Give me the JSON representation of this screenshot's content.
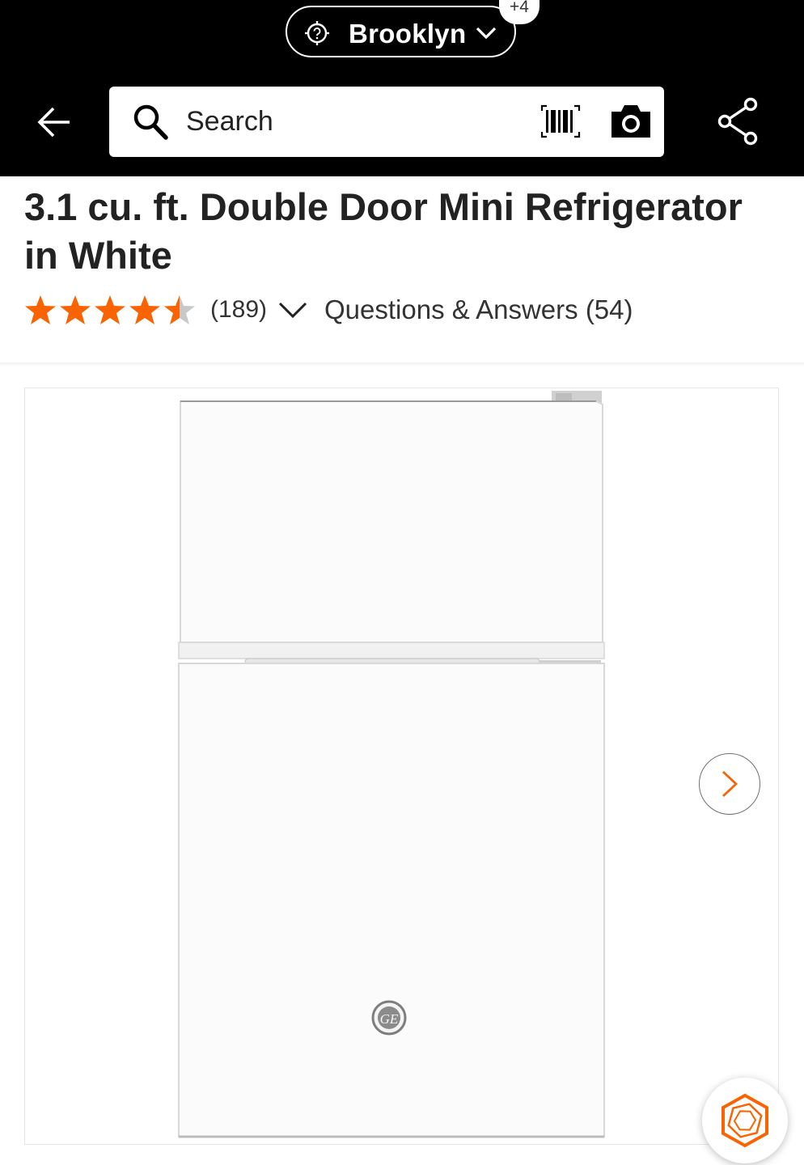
{
  "header": {
    "store": {
      "name": "Brooklyn",
      "badge": "+4"
    },
    "search": {
      "placeholder": "Search"
    },
    "icons": [
      "back-arrow-icon",
      "store-pin-icon",
      "chevron-down-icon",
      "search-icon",
      "barcode-scanner-icon",
      "camera-icon",
      "share-icon"
    ]
  },
  "product": {
    "title": "3.1 cu. ft. Double Door Mini Refrigerator in White",
    "rating": {
      "stars": 4.5,
      "max": 5,
      "count_label": "(189)"
    },
    "qa_label": "Questions & Answers (54)"
  },
  "gallery": {
    "brand_logo": "GE",
    "icons": [
      "chevron-right-icon",
      "assistant-hexagon-icon"
    ]
  },
  "colors": {
    "header_bg": "#000000",
    "accent_orange": "#F96302",
    "text": "#222222"
  }
}
